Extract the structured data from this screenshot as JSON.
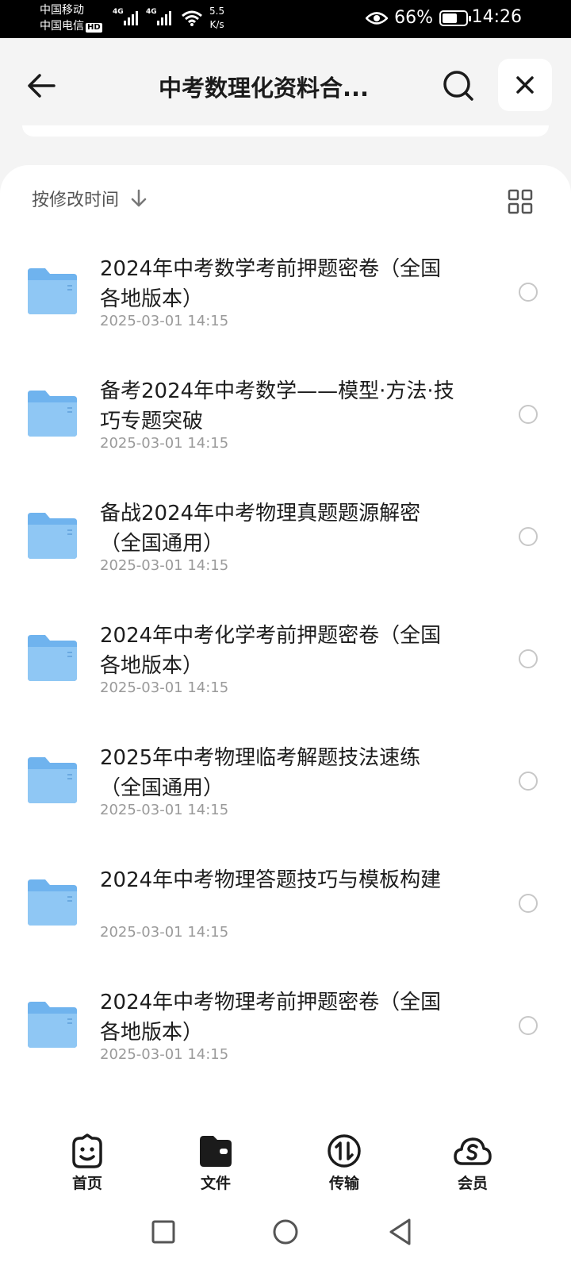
{
  "status_bar": {
    "carrier_1": "中国移动",
    "carrier_2": "中国电信",
    "hd": "HD",
    "net_1": "4G",
    "net_2": "4G",
    "speed_value": "5.5",
    "speed_unit": "K/s",
    "battery": "66%",
    "battery_level": 0.66,
    "time": "14:26"
  },
  "header": {
    "title": "中考数理化资料合...",
    "back_icon": "back-arrow-icon",
    "search_icon": "search-icon",
    "close_icon": "close-icon"
  },
  "sort": {
    "label": "按修改时间",
    "direction_icon": "arrow-down-icon",
    "view_icon": "grid-view-icon"
  },
  "files": [
    {
      "name": "2024年中考数学考前押题密卷（全国各地版本）",
      "date": "2025-03-01 14:15"
    },
    {
      "name": "备考2024年中考数学——模型·方法·技巧专题突破",
      "date": "2025-03-01 14:15"
    },
    {
      "name": "备战2024年中考物理真题题源解密（全国通用）",
      "date": "2025-03-01 14:15"
    },
    {
      "name": "2024年中考化学考前押题密卷（全国各地版本）",
      "date": "2025-03-01 14:15"
    },
    {
      "name": "2025年中考物理临考解题技法速练（全国通用）",
      "date": "2025-03-01 14:15"
    },
    {
      "name": "2024年中考物理答题技巧与模板构建",
      "date": "2025-03-01 14:15"
    },
    {
      "name": "2024年中考物理考前押题密卷（全国各地版本）",
      "date": "2025-03-01 14:15"
    }
  ],
  "tabs": [
    {
      "label": "首页",
      "icon": "smiley-icon"
    },
    {
      "label": "文件",
      "icon": "folder-wallet-icon"
    },
    {
      "label": "传输",
      "icon": "transfer-icon"
    },
    {
      "label": "会员",
      "icon": "cloud-member-icon"
    }
  ],
  "colors": {
    "folder": "#6fb3ee",
    "accent": "#1b1b1b",
    "date_text": "#9a9a9a"
  }
}
